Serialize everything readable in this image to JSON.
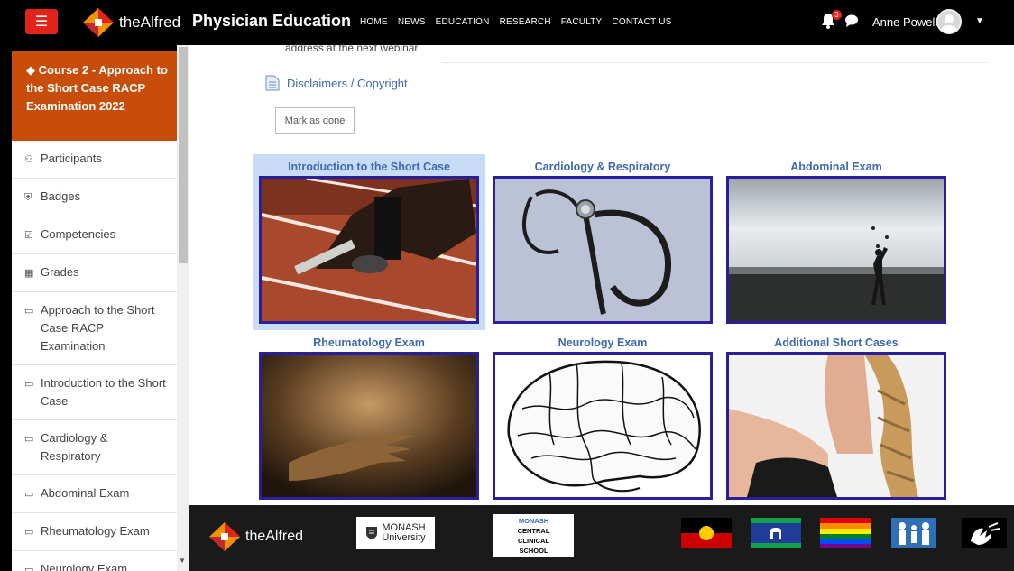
{
  "navbar": {
    "brand_name": "theAlfred",
    "site_title": "Physician Education",
    "links": [
      "HOME",
      "NEWS",
      "EDUCATION",
      "RESEARCH",
      "FACULTY",
      "CONTACT US"
    ],
    "notification_count": "3",
    "user_name": "Anne Powell",
    "brand_color": "#e2231a"
  },
  "sidebar": {
    "course_title": "Course 2 - Approach to the Short Case RACP Examination 2022",
    "course_color": "#c84d0a",
    "items": [
      {
        "icon": "users-icon",
        "glyph": "⚇",
        "label": "Participants"
      },
      {
        "icon": "shield-icon",
        "glyph": "⛨",
        "label": "Badges"
      },
      {
        "icon": "check-square-icon",
        "glyph": "☑",
        "label": "Competencies"
      },
      {
        "icon": "table-icon",
        "glyph": "▦",
        "label": "Grades"
      },
      {
        "icon": "folder-icon",
        "glyph": "▭",
        "label": "Approach to the Short Case RACP Examination"
      },
      {
        "icon": "folder-icon",
        "glyph": "▭",
        "label": "Introduction to the Short Case"
      },
      {
        "icon": "folder-icon",
        "glyph": "▭",
        "label": "Cardiology & Respiratory"
      },
      {
        "icon": "folder-icon",
        "glyph": "▭",
        "label": "Abdominal Exam"
      },
      {
        "icon": "folder-icon",
        "glyph": "▭",
        "label": "Rheumatology Exam"
      },
      {
        "icon": "folder-icon",
        "glyph": "▭",
        "label": "Neurology Exam"
      }
    ]
  },
  "main": {
    "top_text": "address at the next webinar.",
    "disclaimer_link": "Disclaimers / Copyright",
    "mark_done_label": "Mark as done",
    "tiles": [
      {
        "title": "Introduction to the Short Case"
      },
      {
        "title": "Cardiology & Respiratory"
      },
      {
        "title": "Abdominal Exam"
      },
      {
        "title": "Rheumatology Exam"
      },
      {
        "title": "Neurology Exam"
      },
      {
        "title": "Additional Short Cases"
      }
    ]
  },
  "footer": {
    "brand_name": "theAlfred",
    "monash_line1": "MONASH",
    "monash_line2": "University",
    "ccs_line1": "MONASH",
    "ccs_line2": "CENTRAL",
    "ccs_line3": "CLINICAL",
    "ccs_line4": "SCHOOL"
  }
}
